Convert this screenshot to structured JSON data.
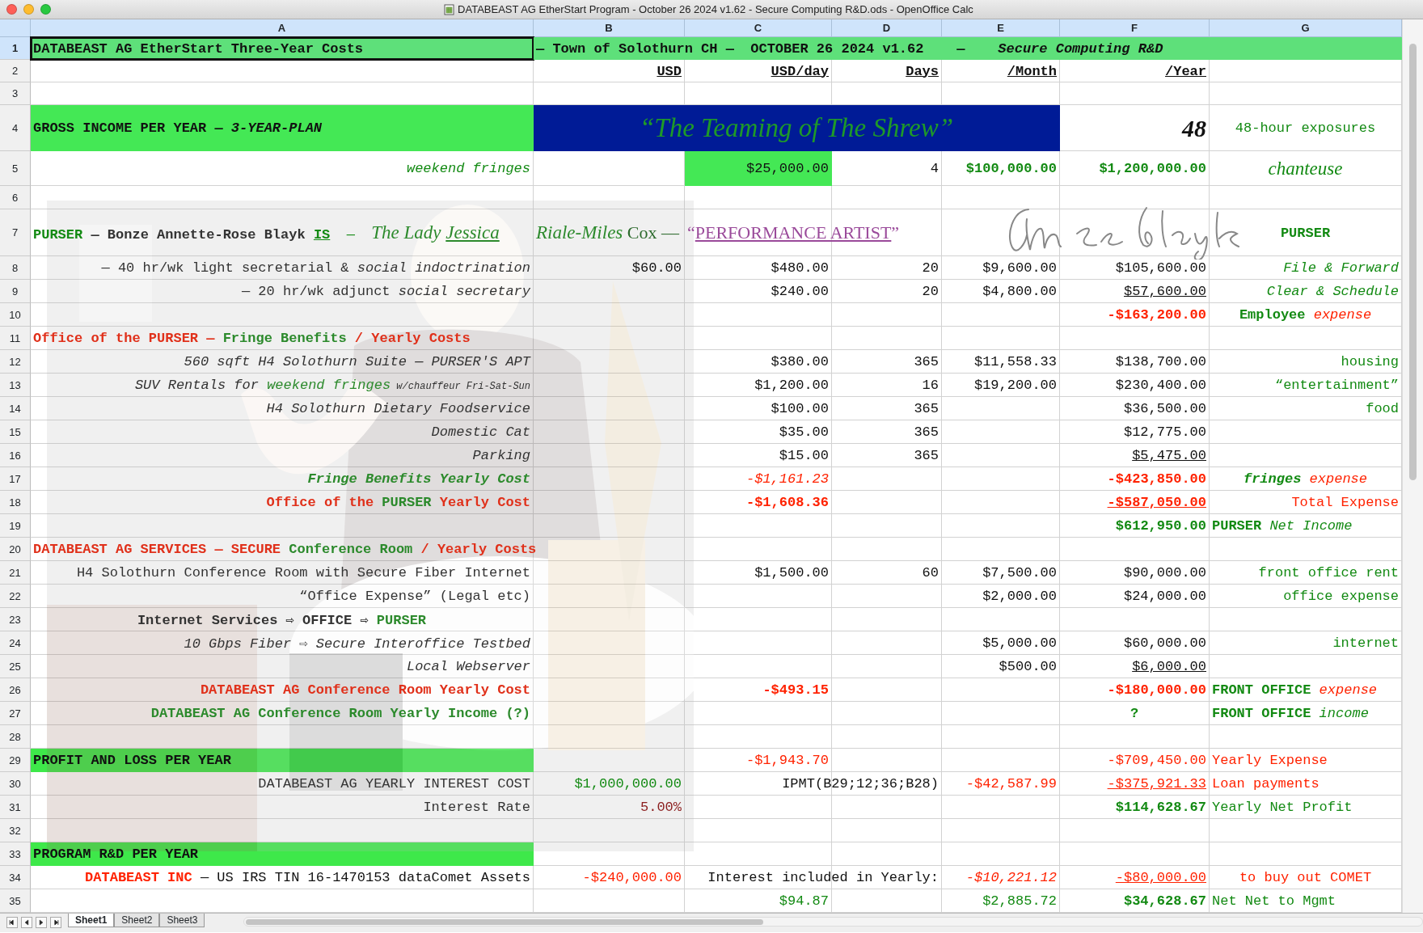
{
  "window": {
    "title": "DATABEAST AG EtherStart Program - October 26 2024 v1.62 - Secure Computing R&D.ods - OpenOffice Calc"
  },
  "columns": [
    "A",
    "B",
    "C",
    "D",
    "E",
    "F",
    "G"
  ],
  "rows": [
    {
      "number": "1",
      "selected": true,
      "cells": [
        {
          "text": "DATABEAST AG EtherStart Three-Year Costs",
          "bold": true
        },
        {
          "text": "— Town of Solothurn CH —  OCTOBER 26 2024 v1.62    —    *Secure Computing R&D*",
          "bold": true
        },
        null,
        null,
        null,
        null,
        null
      ]
    },
    {
      "number": "2",
      "selected": false,
      "cells": [
        null,
        {
          "text": "USD",
          "bold": true,
          "underline": true
        },
        {
          "text": "USD/day",
          "bold": true,
          "underline": true
        },
        {
          "text": "Days",
          "bold": true,
          "underline": true
        },
        {
          "text": "/Month",
          "bold": true,
          "underline": true
        },
        {
          "text": "/Year",
          "bold": true,
          "underline": true
        },
        null
      ]
    },
    {
      "number": "3",
      "selected": false,
      "cells": [
        null,
        null,
        null,
        null,
        null,
        null,
        null
      ]
    },
    {
      "number": "4",
      "selected": false,
      "cells": [
        {
          "text": "GROSS INCOME PER YEAR — *3-YEAR-PLAN*",
          "bold": true
        },
        {
          "text": "“The Teaming of The Shrew”",
          "script": true,
          "color": "#1e9a28"
        },
        null,
        null,
        null,
        {
          "text": "48",
          "serif": true,
          "bold": true,
          "italic": true
        },
        {
          "text": "48-hour exposures",
          "color": "#138a13"
        }
      ]
    },
    {
      "number": "5",
      "selected": false,
      "cells": [
        {
          "text": "weekend fringes",
          "italic": true,
          "color": "#138a13"
        },
        null,
        {
          "text": "$25,000.00"
        },
        {
          "text": "4"
        },
        {
          "text": "$100,000.00",
          "bold": true,
          "color": "#138a13"
        },
        {
          "text": "$1,200,000.00",
          "bold": true,
          "color": "#138a13"
        },
        {
          "text": "chanteuse",
          "script": true,
          "color": "#138a13"
        }
      ]
    },
    {
      "number": "6",
      "selected": false,
      "cells": [
        null,
        null,
        null,
        null,
        null,
        null,
        null
      ]
    },
    {
      "number": "7",
      "selected": false,
      "cells": [
        {
          "parts": [
            {
              "text": "PURSER",
              "bold": true,
              "color": "#138a13"
            },
            {
              "text": " — Bonze Annette-Rose Blayk ",
              "bold": true,
              "color": "#333333"
            },
            {
              "text": "IS",
              "bold": true,
              "underline": true,
              "color": "#138a13"
            },
            {
              "text": "  —  ",
              "color": "#138a13"
            },
            {
              "text": "The Lady ",
              "script": true,
              "color": "#2c8a2c"
            },
            {
              "text": "Jessica",
              "script": true,
              "underline": true,
              "color": "#2c8a2c"
            }
          ]
        },
        {
          "parts": [
            {
              "text": "Riale-Miles",
              "script": true,
              "color": "#2c8a2c"
            },
            {
              "text": " Cox —",
              "serif": true,
              "color": "#2c6a2c"
            }
          ]
        },
        {
          "parts": [
            {
              "text": "“",
              "serif": true,
              "color": "#9a4a9a"
            },
            {
              "text": "PERFORMANCE ARTIST",
              "serif": true,
              "underline": true,
              "color": "#9a4a9a"
            },
            {
              "text": "”",
              "serif": true,
              "color": "#9a4a9a"
            }
          ]
        },
        null,
        {
          "kind": "signature"
        },
        null,
        {
          "text": "PURSER",
          "bold": true,
          "color": "#138a13"
        }
      ]
    },
    {
      "number": "8",
      "selected": false,
      "cells": [
        {
          "text": "— 40 hr/wk light secretarial & *social indoctrination*",
          "color": "#333333"
        },
        {
          "text": "$60.00"
        },
        {
          "text": "$480.00"
        },
        {
          "text": "20"
        },
        {
          "text": "$9,600.00"
        },
        {
          "text": "$105,600.00"
        },
        {
          "text": "File & Forward",
          "italic": true,
          "color": "#138a13"
        }
      ]
    },
    {
      "number": "9",
      "selected": false,
      "cells": [
        {
          "text": "— 20 hr/wk adjunct *social secretary*",
          "color": "#333333"
        },
        null,
        {
          "text": "$240.00"
        },
        {
          "text": "20"
        },
        {
          "text": "$4,800.00"
        },
        {
          "text": "$57,600.00",
          "underline": true
        },
        {
          "text": "Clear & Schedule",
          "italic": true,
          "color": "#138a13"
        }
      ]
    },
    {
      "number": "10",
      "selected": false,
      "cells": [
        null,
        null,
        null,
        null,
        null,
        {
          "text": "-$163,200.00",
          "bold": true,
          "color": "#ff2200"
        },
        {
          "parts": [
            {
              "text": "Employee",
              "bold": true,
              "color": "#138a13"
            },
            {
              "text": " expense",
              "italic": true,
              "color": "#ff2200"
            }
          ]
        }
      ]
    },
    {
      "number": "11",
      "selected": false,
      "cells": [
        {
          "parts": [
            {
              "text": "Office of the PURSER — ",
              "bold": true,
              "color": "#e0301a"
            },
            {
              "text": "Fringe Benefits",
              "bold": true,
              "color": "#2c8a2c"
            },
            {
              "text": " / Yearly Costs",
              "bold": true,
              "color": "#e0301a"
            }
          ]
        },
        null,
        null,
        null,
        null,
        null,
        null
      ]
    },
    {
      "number": "12",
      "selected": false,
      "cells": [
        {
          "text": "560 sqft H4 Solothurn Suite — PURSER'S APT",
          "italic": true,
          "color": "#333333"
        },
        null,
        {
          "text": "$380.00"
        },
        {
          "text": "365"
        },
        {
          "text": "$11,558.33"
        },
        {
          "text": "$138,700.00"
        },
        {
          "text": "housing",
          "color": "#138a13"
        }
      ]
    },
    {
      "number": "13",
      "selected": false,
      "cells": [
        {
          "parts": [
            {
              "text": "SUV Rentals for ",
              "italic": true,
              "color": "#333333"
            },
            {
              "text": "weekend fringes",
              "italic": true,
              "color": "#2c8a2c"
            },
            {
              "text": " w/chauffeur Fri-Sat-Sun",
              "italic": true,
              "small": true,
              "color": "#333333"
            }
          ]
        },
        null,
        {
          "text": "$1,200.00"
        },
        {
          "text": "16"
        },
        {
          "text": "$19,200.00"
        },
        {
          "text": "$230,400.00"
        },
        {
          "text": "“entertainment”",
          "color": "#138a13"
        }
      ]
    },
    {
      "number": "14",
      "selected": false,
      "cells": [
        {
          "text": "H4 Solothurn Dietary Foodservice",
          "italic": true,
          "color": "#333333"
        },
        null,
        {
          "text": "$100.00"
        },
        {
          "text": "365"
        },
        null,
        {
          "text": "$36,500.00"
        },
        {
          "text": "food",
          "color": "#138a13"
        }
      ]
    },
    {
      "number": "15",
      "selected": false,
      "cells": [
        {
          "text": "Domestic Cat",
          "italic": true,
          "color": "#333333"
        },
        null,
        {
          "text": "$35.00"
        },
        {
          "text": "365"
        },
        null,
        {
          "text": "$12,775.00"
        },
        null
      ]
    },
    {
      "number": "16",
      "selected": false,
      "cells": [
        {
          "text": "Parking",
          "italic": true,
          "color": "#333333"
        },
        null,
        {
          "text": "$15.00"
        },
        {
          "text": "365"
        },
        null,
        {
          "text": "$5,475.00",
          "underline": true
        },
        null
      ]
    },
    {
      "number": "17",
      "selected": false,
      "cells": [
        {
          "text": "Fringe Benefits Yearly Cost",
          "bold": true,
          "italic": true,
          "color": "#2c8a2c"
        },
        null,
        {
          "text": "-$1,161.23",
          "italic": true,
          "color": "#ff2200"
        },
        null,
        null,
        {
          "text": "-$423,850.00",
          "bold": true,
          "color": "#ff2200"
        },
        {
          "parts": [
            {
              "text": "fringes",
              "bold": true,
              "italic": true,
              "color": "#138a13"
            },
            {
              "text": " expense",
              "italic": true,
              "color": "#ff2200"
            }
          ]
        }
      ]
    },
    {
      "number": "18",
      "selected": false,
      "cells": [
        {
          "parts": [
            {
              "text": "Office of the ",
              "bold": true,
              "color": "#e0301a"
            },
            {
              "text": "PURSER",
              "bold": true,
              "color": "#2c8a2c"
            },
            {
              "text": " Yearly Cost",
              "bold": true,
              "color": "#e0301a"
            }
          ]
        },
        null,
        {
          "text": "-$1,608.36",
          "bold": true,
          "color": "#ff2200"
        },
        null,
        null,
        {
          "text": "-$587,050.00",
          "bold": true,
          "underline": true,
          "color": "#ff2200"
        },
        {
          "text": "Total Expense",
          "color": "#ff2200"
        }
      ]
    },
    {
      "number": "19",
      "selected": false,
      "cells": [
        null,
        null,
        null,
        null,
        null,
        {
          "text": "$612,950.00",
          "bold": true,
          "color": "#138a13"
        },
        {
          "parts": [
            {
              "text": "PURSER",
              "bold": true,
              "color": "#138a13"
            },
            {
              "text": " Net Income",
              "italic": true,
              "color": "#138a13"
            }
          ]
        }
      ]
    },
    {
      "number": "20",
      "selected": false,
      "cells": [
        {
          "parts": [
            {
              "text": "DATABEAST AG SERVICES — SECURE ",
              "bold": true,
              "color": "#e0301a"
            },
            {
              "text": "Conference Room",
              "bold": true,
              "color": "#2c8a2c"
            },
            {
              "text": " / Yearly Costs",
              "bold": true,
              "color": "#e0301a"
            }
          ]
        },
        null,
        null,
        null,
        null,
        null,
        null
      ]
    },
    {
      "number": "21",
      "selected": false,
      "cells": [
        {
          "text": "H4 Solothurn Conference Room with Secure Fiber Internet",
          "color": "#333333"
        },
        null,
        {
          "text": "$1,500.00"
        },
        {
          "text": "60"
        },
        {
          "text": "$7,500.00"
        },
        {
          "text": "$90,000.00"
        },
        {
          "text": "front office rent",
          "color": "#138a13"
        }
      ]
    },
    {
      "number": "22",
      "selected": false,
      "cells": [
        {
          "text": "“Office Expense” (Legal etc)",
          "color": "#333333"
        },
        null,
        null,
        null,
        {
          "text": "$2,000.00"
        },
        {
          "text": "$24,000.00"
        },
        {
          "text": "office expense",
          "color": "#138a13"
        }
      ]
    },
    {
      "number": "23",
      "selected": false,
      "cells": [
        {
          "parts": [
            {
              "text": "Internet Services ⇨ OFFICE ⇨ ",
              "bold": true,
              "color": "#333333"
            },
            {
              "text": "PURSER",
              "bold": true,
              "color": "#2c8a2c"
            }
          ]
        },
        null,
        null,
        null,
        null,
        null,
        null
      ]
    },
    {
      "number": "24",
      "selected": false,
      "cells": [
        {
          "text": "10 Gbps Fiber ⇨ Secure Interoffice Testbed",
          "italic": true,
          "color": "#333333"
        },
        null,
        null,
        null,
        {
          "text": "$5,000.00"
        },
        {
          "text": "$60,000.00"
        },
        {
          "text": "internet",
          "color": "#138a13"
        }
      ]
    },
    {
      "number": "25",
      "selected": false,
      "cells": [
        {
          "text": "Local Webserver",
          "italic": true,
          "color": "#333333"
        },
        null,
        null,
        null,
        {
          "text": "$500.00"
        },
        {
          "text": "$6,000.00",
          "underline": true
        },
        null
      ]
    },
    {
      "number": "26",
      "selected": false,
      "cells": [
        {
          "text": "DATABEAST AG Conference Room Yearly Cost",
          "bold": true,
          "color": "#e0301a"
        },
        null,
        {
          "text": "-$493.15",
          "bold": true,
          "color": "#ff2200"
        },
        null,
        null,
        {
          "text": "-$180,000.00",
          "bold": true,
          "color": "#ff2200"
        },
        {
          "parts": [
            {
              "text": "FRONT OFFICE",
              "bold": true,
              "color": "#138a13"
            },
            {
              "text": " expense",
              "italic": true,
              "color": "#ff2200"
            }
          ]
        }
      ]
    },
    {
      "number": "27",
      "selected": false,
      "cells": [
        {
          "text": "DATABEAST AG Conference Room Yearly Income (?)",
          "bold": true,
          "color": "#2c8a2c"
        },
        null,
        null,
        null,
        null,
        {
          "text": "?",
          "bold": true,
          "color": "#138a13"
        },
        {
          "parts": [
            {
              "text": "FRONT OFFICE",
              "bold": true,
              "color": "#138a13"
            },
            {
              "text": " income",
              "italic": true,
              "color": "#138a13"
            }
          ]
        }
      ]
    },
    {
      "number": "28",
      "selected": false,
      "cells": [
        null,
        null,
        null,
        null,
        null,
        null,
        null
      ]
    },
    {
      "number": "29",
      "selected": false,
      "cells": [
        {
          "text": "PROFIT AND LOSS PER YEAR",
          "bold": true
        },
        null,
        {
          "text": "-$1,943.70",
          "color": "#ff2200"
        },
        null,
        null,
        {
          "text": "-$709,450.00",
          "color": "#ff2200"
        },
        {
          "text": "Yearly Expense",
          "color": "#ff2200"
        }
      ]
    },
    {
      "number": "30",
      "selected": false,
      "cells": [
        {
          "text": "DATABEAST AG YEARLY INTEREST COST",
          "color": "#333333"
        },
        {
          "text": "$1,000,000.00",
          "color": "#138a13"
        },
        null,
        {
          "text": "IPMT(B29;12;36;B28)"
        },
        {
          "text": "-$42,587.99",
          "color": "#ff2200"
        },
        {
          "text": "-$375,921.33",
          "underline": true,
          "color": "#ff2200"
        },
        {
          "text": "Loan payments",
          "color": "#ff2200"
        }
      ]
    },
    {
      "number": "31",
      "selected": false,
      "cells": [
        {
          "text": "Interest Rate",
          "color": "#333333"
        },
        {
          "text": "5.00%",
          "color": "#8b1d1d"
        },
        null,
        null,
        null,
        {
          "text": "$114,628.67",
          "bold": true,
          "color": "#138a13"
        },
        {
          "text": "Yearly Net Profit",
          "color": "#138a13"
        }
      ]
    },
    {
      "number": "32",
      "selected": false,
      "cells": [
        null,
        null,
        null,
        null,
        null,
        null,
        null
      ]
    },
    {
      "number": "33",
      "selected": false,
      "cells": [
        {
          "text": "PROGRAM R&D PER YEAR",
          "bold": true
        },
        null,
        null,
        null,
        null,
        null,
        null
      ]
    },
    {
      "number": "34",
      "selected": false,
      "cells": [
        {
          "parts": [
            {
              "text": "DATABEAST INC",
              "bold": true,
              "color": "#ff2200"
            },
            {
              "text": " — US IRS TIN 16-1470153 dataComet Assets",
              "color": "#111111"
            }
          ]
        },
        {
          "text": "-$240,000.00",
          "color": "#ff2200"
        },
        null,
        {
          "text": "Interest included in Yearly:"
        },
        {
          "text": "-$10,221.12",
          "italic": true,
          "color": "#ff2200"
        },
        {
          "text": "-$80,000.00",
          "underline": true,
          "color": "#ff2200"
        },
        {
          "text": "to buy out COMET",
          "color": "#ff2200"
        }
      ]
    },
    {
      "number": "35",
      "selected": false,
      "cells": [
        null,
        null,
        {
          "text": "$94.87",
          "color": "#138a13"
        },
        null,
        {
          "text": "$2,885.72",
          "color": "#138a13"
        },
        {
          "text": "$34,628.67",
          "bold": true,
          "color": "#138a13"
        },
        {
          "text": "Net Net to Mgmt",
          "color": "#138a13"
        }
      ]
    }
  ],
  "sheet_tabs": [
    {
      "label": "Sheet1",
      "selected": true
    },
    {
      "label": "Sheet2",
      "selected": false
    },
    {
      "label": "Sheet3",
      "selected": false
    }
  ]
}
